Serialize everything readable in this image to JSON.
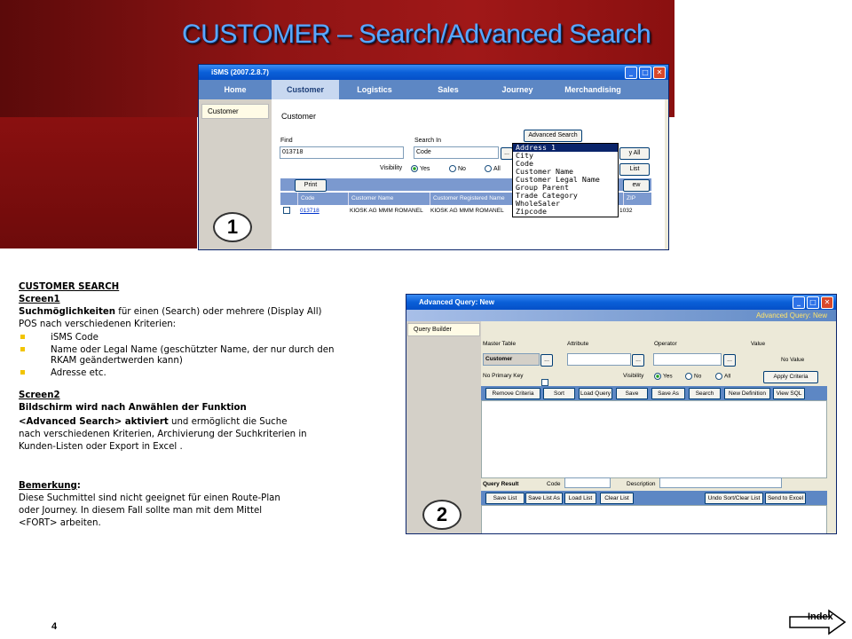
{
  "slide": {
    "title": "CUSTOMER – Search/Advanced Search",
    "page_number": "4",
    "index_label": "Index"
  },
  "window1": {
    "title": "iSMS (2007.2.8.7)",
    "nav": [
      "Home",
      "Customer",
      "Logistics",
      "Sales",
      "Journey",
      "Merchandising"
    ],
    "active_nav": "Customer",
    "sidebar_item": "Customer",
    "heading": "Customer",
    "advanced_search_button": "Advanced Search",
    "find_label": "Find",
    "find_value": "013718",
    "search_in_label": "Search In",
    "search_in_value": "Code",
    "browse_button": "...",
    "display_all_button": "y All",
    "list_button": "List",
    "visibility_label": "Visibility",
    "visibility_options": [
      "Yes",
      "No",
      "All"
    ],
    "print_button": "Print",
    "new_button": "ew",
    "table_headers": [
      "Code",
      "Customer Name",
      "Customer Registered Name",
      "ZIP"
    ],
    "table_rows": [
      {
        "code": "013718",
        "name": "KIOSK AG MMM ROMANEL",
        "registered": "KIOSK AG MMM ROMANEL",
        "extra": "R",
        "zip": "1032"
      }
    ],
    "dropdown_options": [
      "Address 1",
      "City",
      "Code",
      "Customer Name",
      "Customer Legal Name",
      "Group Parent",
      "Trade Category",
      "WholeSaler",
      "Zipcode"
    ],
    "dropdown_selected": "Address 1",
    "callout": "1"
  },
  "description": {
    "heading": "CUSTOMER SEARCH",
    "screen1_label": "Screen1",
    "line1_bold": "Suchmöglichkeiten",
    "line1_rest": " für einen (Search) oder mehrere  (Display All)",
    "line2": "POS nach verschiedenen Kriterien:",
    "bullets": [
      [
        "iSMS Code"
      ],
      [
        "Name oder Legal Name (geschützter Name, der nur durch den",
        "RKAM geändertwerden kann)"
      ],
      [
        "Adresse etc."
      ]
    ],
    "screen2_label": "Screen2",
    "screen2_line1": "Bildschirm wird nach Anwählen der Funktion",
    "screen2_line2_bold": "<Advanced Search> aktiviert",
    "screen2_line2_rest": "  und ermöglicht die Suche",
    "screen2_line3": "nach verschiedenen Kriterien, Archivierung der Suchkriterien in",
    "screen2_line4": "Kunden-Listen oder Export in Excel .",
    "remark_label": "Bemerkung",
    "remark_colon": ":",
    "remark_line1": "Diese Suchmittel sind nicht geeignet für einen Route-Plan",
    "remark_line2": "oder Journey. In diesem Fall sollte man mit dem Mittel",
    "remark_line3": "<FORT> arbeiten."
  },
  "window2": {
    "title": "Advanced Query: New",
    "banner": "Advanced Query: New",
    "sidebar_item": "Query Builder",
    "master_table_label": "Master Table",
    "master_table_value": "Customer",
    "attribute_label": "Attribute",
    "operator_label": "Operator",
    "value_label": "Value",
    "value_text": "No Value",
    "browse_button": "...",
    "no_primary_key_label": "No Primary Key",
    "visibility_label": "Visibility",
    "visibility_options": [
      "Yes",
      "No",
      "All"
    ],
    "apply_criteria_button": "Apply Criteria",
    "toolbar1": [
      "Remove Criteria",
      "Sort",
      "Load Query",
      "Save",
      "Save As",
      "Search",
      "New Definition",
      "View SQL"
    ],
    "query_result_label": "Query Result",
    "code_label": "Code",
    "description_label": "Description",
    "toolbar2_left": [
      "Save List",
      "Save List As",
      "Load List",
      "Clear List"
    ],
    "toolbar2_right": [
      "Undo Sort/Clear List",
      "Send to Excel"
    ],
    "callout": "2"
  }
}
